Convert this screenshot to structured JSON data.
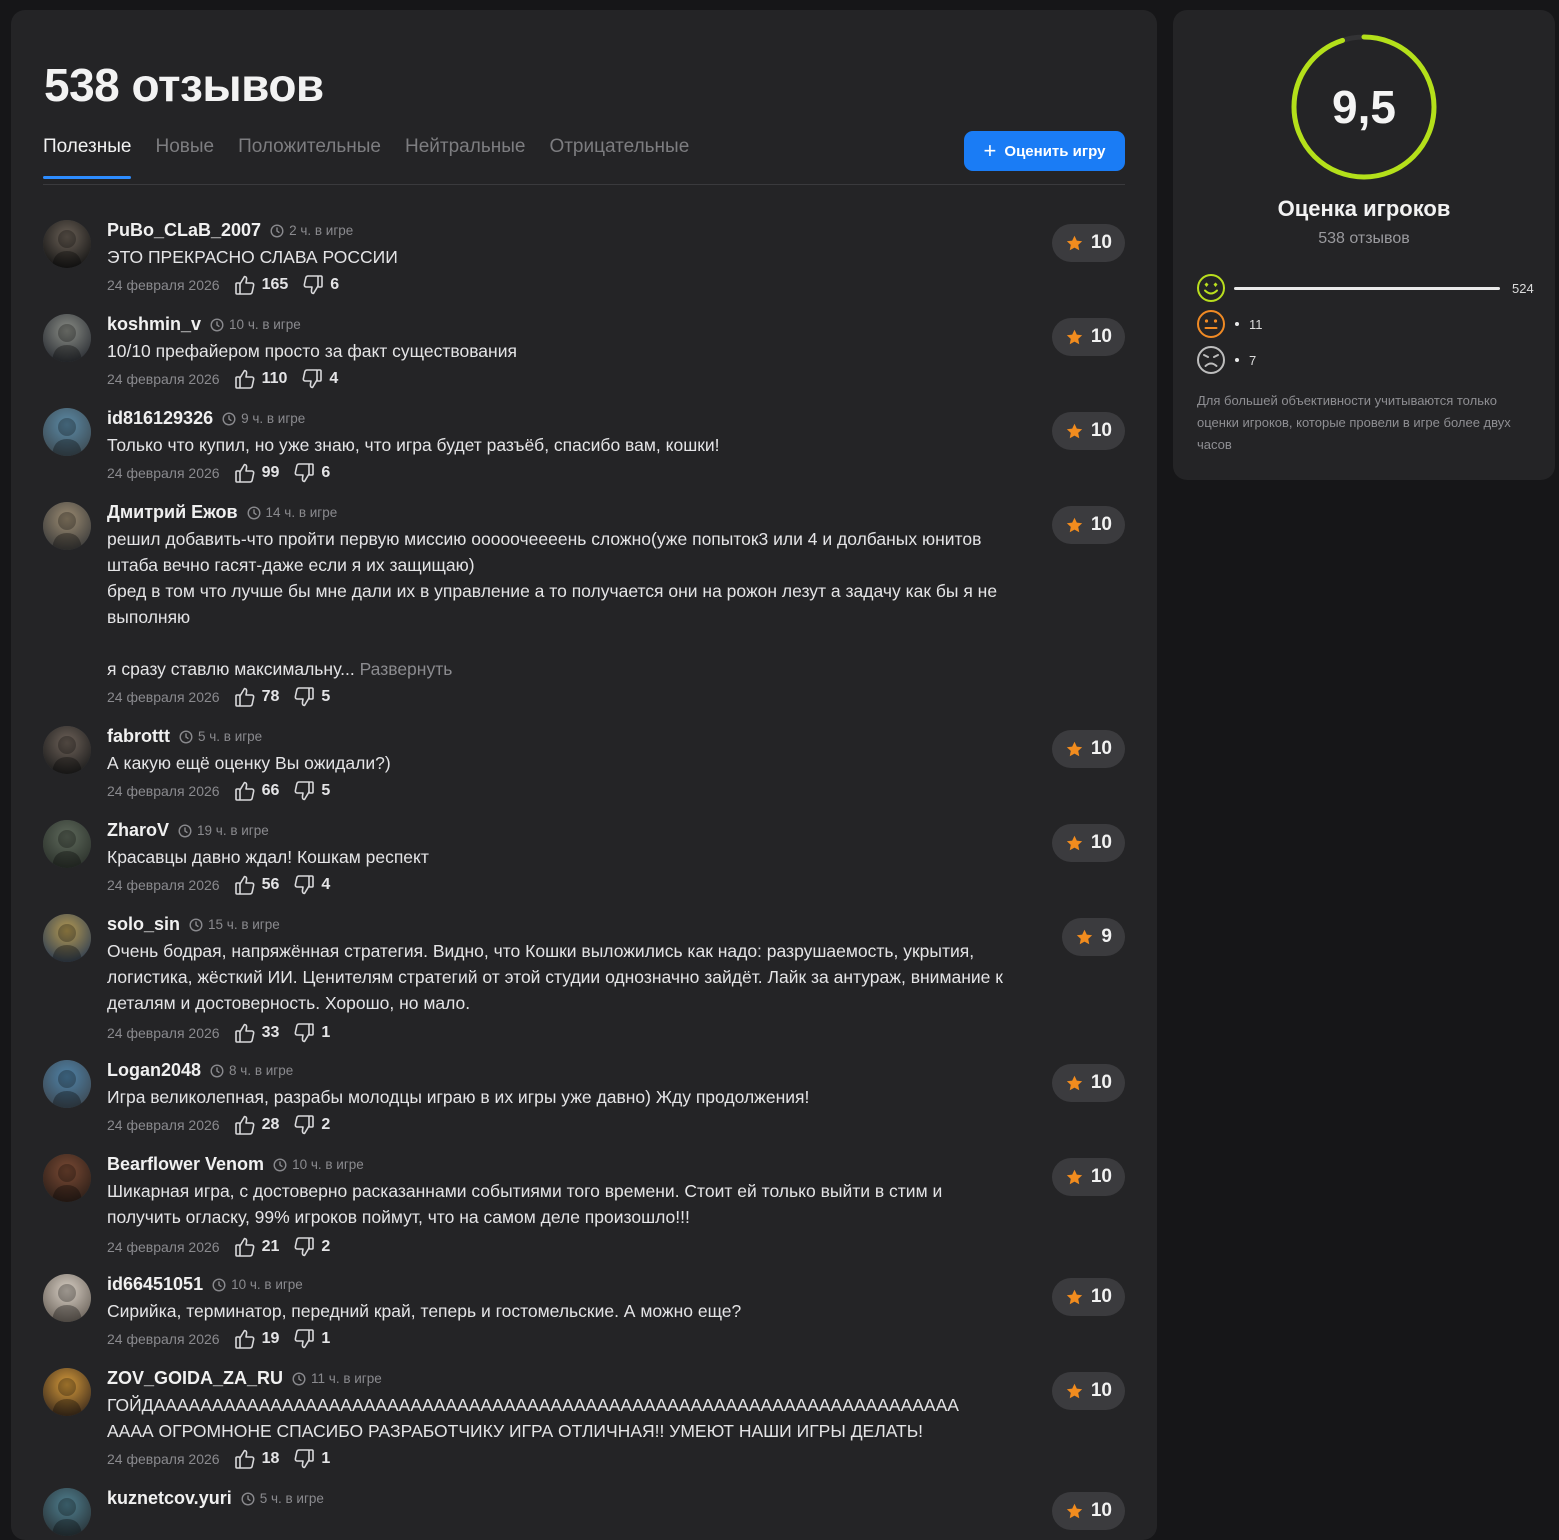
{
  "header": {
    "title": "538 отзывов",
    "tabs": [
      "Полезные",
      "Новые",
      "Положительные",
      "Нейтральные",
      "Отрицательные"
    ],
    "rate_button": "Оценить игру"
  },
  "summary": {
    "score": "9,5",
    "score_fraction": 0.95,
    "title": "Оценка игроков",
    "count": "538 отзывов",
    "positive_count": "524",
    "neutral_count": "11",
    "negative_count": "7",
    "note": "Для большей объективности учитываются только оценки игроков, которые провели в игре более двух часов",
    "colors": {
      "ring": "#b4e01a",
      "positive": "#b9de1e",
      "neutral": "#f08a24",
      "negative": "#bdbdbd"
    }
  },
  "reviews": [
    {
      "author": "PuBo_CLaB_2007",
      "playtime": "2 ч. в игре",
      "text": "ЭТО ПРЕКРАСНО СЛАВА РОССИИ",
      "date": "24 февраля 2026",
      "likes": "165",
      "dislikes": "6",
      "score": "10"
    },
    {
      "author": "koshmin_v",
      "playtime": "10 ч. в игре",
      "text": "10/10 префайером просто за факт существования",
      "date": "24 февраля 2026",
      "likes": "110",
      "dislikes": "4",
      "score": "10"
    },
    {
      "author": "id816129326",
      "playtime": "9 ч. в игре",
      "text": "Только что купил, но уже знаю, что игра будет разъёб, спасибо вам, кошки!",
      "date": "24 февраля 2026",
      "likes": "99",
      "dislikes": "6",
      "score": "10"
    },
    {
      "author": "Дмитрий Ежов",
      "playtime": "14 ч. в игре",
      "text": "решил добавить-что пройти первую миссию ооооочеееень сложно(уже попыток3 или 4 и долбаных юнитов штаба вечно гасят-даже если я их защищаю)\nбред в том что лучше бы мне дали их в управление а то получается они на рожон лезут а задачу как бы я не выполняю\n\nя сразу ставлю максимальну...",
      "expand": "Развернуть",
      "date": "24 февраля 2026",
      "likes": "78",
      "dislikes": "5",
      "score": "10"
    },
    {
      "author": "fabrottt",
      "playtime": "5 ч. в игре",
      "text": "А какую ещё оценку Вы ожидали?)",
      "date": "24 февраля 2026",
      "likes": "66",
      "dislikes": "5",
      "score": "10"
    },
    {
      "author": "ZharoV",
      "playtime": "19 ч. в игре",
      "text": "Красавцы давно ждал! Кошкам респект",
      "date": "24 февраля 2026",
      "likes": "56",
      "dislikes": "4",
      "score": "10"
    },
    {
      "author": "solo_sin",
      "playtime": "15 ч. в игре",
      "text": "Очень бодрая, напряжённая стратегия. Видно, что Кошки выложились как надо: разрушаемость, укрытия, логистика, жёсткий ИИ. Ценителям стратегий от этой студии однозначно зайдёт. Лайк за антураж, внимание к деталям и достоверность. Хорошо, но мало.",
      "date": "24 февраля 2026",
      "likes": "33",
      "dislikes": "1",
      "score": "9"
    },
    {
      "author": "Logan2048",
      "playtime": "8 ч. в игре",
      "text": "Игра великолепная, разрабы молодцы играю в их игры уже давно) Жду продолжения!",
      "date": "24 февраля 2026",
      "likes": "28",
      "dislikes": "2",
      "score": "10"
    },
    {
      "author": "Bearflower Venom",
      "playtime": "10 ч. в игре",
      "text": "Шикарная игра, с достоверно расказаннами событиями того времени. Стоит ей только выйти в стим и получить огласку, 99% игроков поймут, что на самом деле произошло!!!",
      "date": "24 февраля 2026",
      "likes": "21",
      "dislikes": "2",
      "score": "10"
    },
    {
      "author": "id66451051",
      "playtime": "10 ч. в игре",
      "text": "Сирийка, терминатор, передний край, теперь и гостомельские. А можно еще?",
      "date": "24 февраля 2026",
      "likes": "19",
      "dislikes": "1",
      "score": "10"
    },
    {
      "author": "ZOV_GOIDA_ZA_RU",
      "playtime": "11 ч. в игре",
      "text": "ГОЙДААААААААААААААААААААААААААААААААААААААААААААААААААААААААААААААААААААА\nАААА ОГРОМНОНЕ СПАСИБО РАЗРАБОТЧИКУ ИГРА ОТЛИЧНАЯ!! УМЕЮТ НАШИ ИГРЫ ДЕЛАТЬ!",
      "date": "24 февраля 2026",
      "likes": "18",
      "dislikes": "1",
      "score": "10"
    },
    {
      "author": "kuznetcov.yuri",
      "playtime": "5 ч. в игре",
      "text": "",
      "date": "",
      "likes": "",
      "dislikes": "",
      "score": "10"
    }
  ]
}
